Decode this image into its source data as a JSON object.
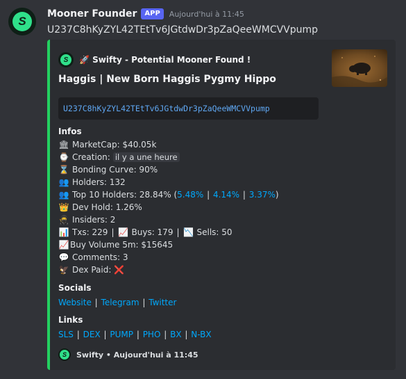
{
  "message": {
    "author": "Mooner Founder",
    "badge": "APP",
    "timestamp": "Aujourd'hui à 11:45",
    "content": "U237C8hKyZYL42TEtTv6JGtdwDr3pZaQeeWMCVVpump"
  },
  "embed": {
    "accent_color": "#23d160",
    "author_prefix": "🚀",
    "author_name": "Swifty - Potential Mooner Found !",
    "title": "Haggis | New Born Haggis Pygmy Hippo",
    "contract": "U237C8hKyZYL42TEtTv6JGtdwDr3pZaQeeWMCVVpump",
    "infos_label": "Infos",
    "infos": {
      "marketcap": {
        "icon": "bank-icon",
        "text": "MarketCap: $40.05k"
      },
      "creation": {
        "icon": "clock-icon",
        "label": "Creation:",
        "value": "il y a une heure"
      },
      "bonding": {
        "icon": "hourglass-icon",
        "text": "Bonding Curve: 90%"
      },
      "holders": {
        "icon": "users-icon",
        "text": "Holders: 132"
      },
      "top10": {
        "icon": "users-icon",
        "label": "Top 10 Holders: 28.84% (",
        "links": [
          "5.48%",
          "4.14%",
          "3.37%"
        ],
        "suffix": ")"
      },
      "devhold": {
        "icon": "crown-icon",
        "text": "Dev Hold: 1.26%"
      },
      "insiders": {
        "icon": "ninja-icon",
        "text": "Insiders: 2"
      },
      "txs": {
        "text": "Txs: 229",
        "buys": "Buys: 179",
        "sells": "Sells: 50"
      },
      "buyvolume": {
        "icon": "chart-up-icon",
        "text": "Buy Volume 5m: $15645"
      },
      "comments": {
        "icon": "speech-bubble-icon",
        "text": "Comments: 3"
      },
      "dexpaid": {
        "icon": "eagle-icon",
        "label": "Dex Paid:",
        "value": "❌"
      }
    },
    "socials_label": "Socials",
    "socials": [
      "Website",
      "Telegram",
      "Twitter"
    ],
    "links_label": "Links",
    "links": [
      "SLS",
      "DEX",
      "PUMP",
      "PHO",
      "BX",
      "N-BX"
    ],
    "footer": {
      "name": "Swifty",
      "dot": "•",
      "time": "Aujourd'hui à 11:45"
    }
  },
  "colors": {
    "background": "#313338",
    "embed_bg": "#2b2d31",
    "link": "#00a8fc",
    "app_badge": "#5865f2",
    "code_text": "#5fa7f2"
  }
}
